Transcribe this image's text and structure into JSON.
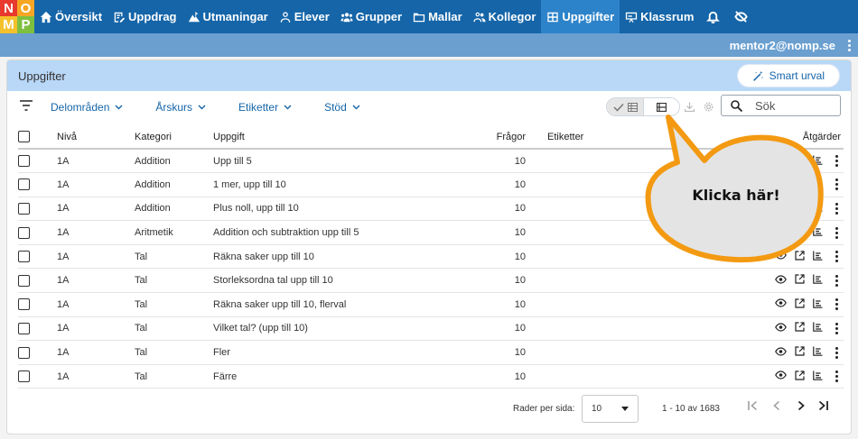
{
  "logo": {
    "letters": [
      "N",
      "O",
      "M",
      "P"
    ],
    "colors": [
      "#e8392e",
      "#f6a623",
      "#f4c12c",
      "#7fbf3f"
    ]
  },
  "nav": {
    "items": [
      {
        "label": "Översikt",
        "icon": "home-icon"
      },
      {
        "label": "Uppdrag",
        "icon": "assignment-icon"
      },
      {
        "label": "Utmaningar",
        "icon": "challenge-icon"
      },
      {
        "label": "Elever",
        "icon": "person-icon"
      },
      {
        "label": "Grupper",
        "icon": "group-icon"
      },
      {
        "label": "Mallar",
        "icon": "folder-icon"
      },
      {
        "label": "Kollegor",
        "icon": "colleagues-icon"
      },
      {
        "label": "Uppgifter",
        "icon": "grid-icon",
        "active": true
      },
      {
        "label": "Klassrum",
        "icon": "classroom-icon"
      }
    ],
    "extra_icons": [
      "bell-icon",
      "eye-off-icon"
    ]
  },
  "userbar": {
    "email": "mentor2@nomp.se"
  },
  "card": {
    "title": "Uppgifter",
    "smart_button": "Smart urval"
  },
  "toolbar": {
    "filters": [
      "Delområden",
      "Årskurs",
      "Etiketter",
      "Stöd"
    ],
    "search_placeholder": "Sök"
  },
  "table": {
    "columns": [
      "Nivå",
      "Kategori",
      "Uppgift",
      "Frågor",
      "Etiketter",
      "Åtgärder"
    ],
    "rows": [
      {
        "niva": "1A",
        "kategori": "Addition",
        "uppgift": "Upp till 5",
        "fragor": "10"
      },
      {
        "niva": "1A",
        "kategori": "Addition",
        "uppgift": "1 mer, upp till 10",
        "fragor": "10"
      },
      {
        "niva": "1A",
        "kategori": "Addition",
        "uppgift": "Plus noll, upp till 10",
        "fragor": "10"
      },
      {
        "niva": "1A",
        "kategori": "Aritmetik",
        "uppgift": "Addition och subtraktion upp till 5",
        "fragor": "10"
      },
      {
        "niva": "1A",
        "kategori": "Tal",
        "uppgift": "Räkna saker upp till 10",
        "fragor": "10"
      },
      {
        "niva": "1A",
        "kategori": "Tal",
        "uppgift": "Storleksordna tal upp till 10",
        "fragor": "10"
      },
      {
        "niva": "1A",
        "kategori": "Tal",
        "uppgift": "Räkna saker upp till 10, flerval",
        "fragor": "10"
      },
      {
        "niva": "1A",
        "kategori": "Tal",
        "uppgift": "Vilket tal? (upp till 10)",
        "fragor": "10"
      },
      {
        "niva": "1A",
        "kategori": "Tal",
        "uppgift": "Fler",
        "fragor": "10"
      },
      {
        "niva": "1A",
        "kategori": "Tal",
        "uppgift": "Färre",
        "fragor": "10"
      }
    ]
  },
  "pager": {
    "rows_label": "Rader per sida:",
    "rows_value": "10",
    "range": "1 - 10 av 1683"
  },
  "callout": {
    "text": "Klicka här!",
    "fill": "#e4e4e4",
    "stroke": "#f39a12"
  }
}
